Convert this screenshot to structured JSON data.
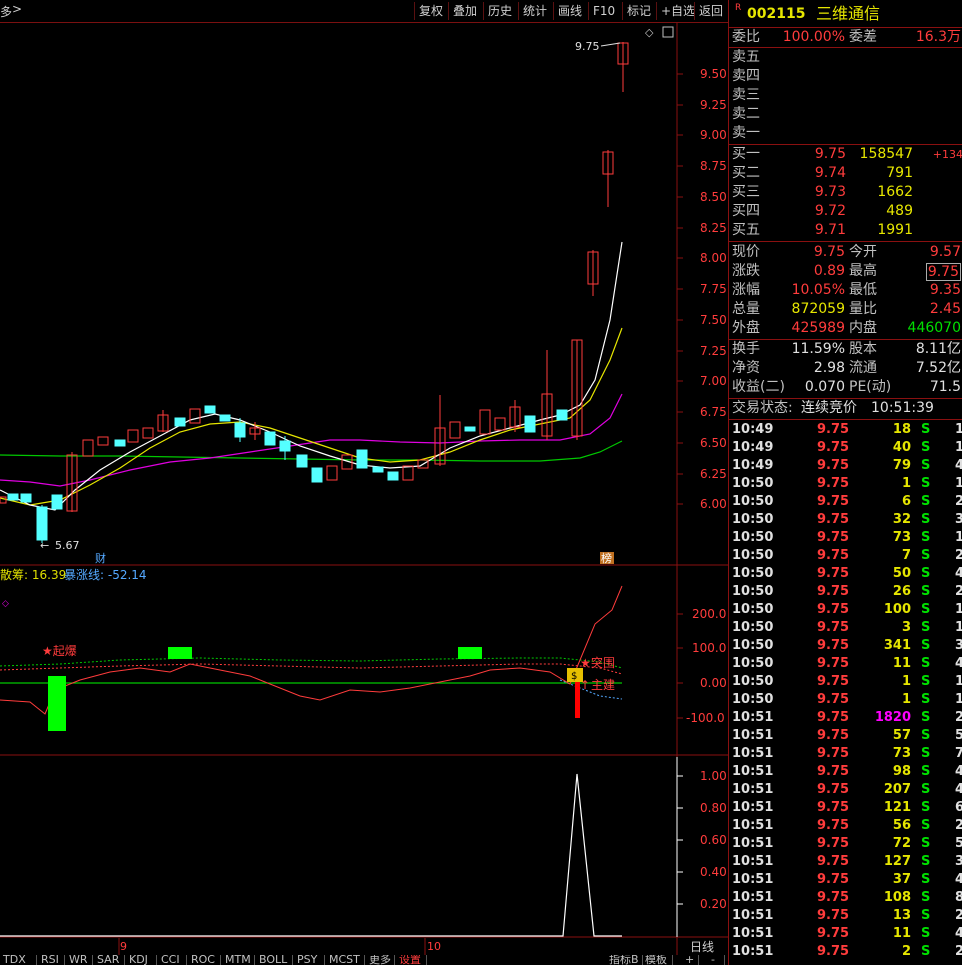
{
  "topbar": {
    "left_label": "多",
    "buttons": [
      "复权",
      "叠加",
      "历史",
      "统计",
      "画线",
      "F10",
      "标记",
      "+自选",
      "返回"
    ]
  },
  "stock": {
    "marker": "R",
    "code": "002115",
    "name": "三维通信"
  },
  "order_ratio": {
    "label1": "委比",
    "value1": "100.00%",
    "label2": "委差",
    "value2": "16.3万"
  },
  "sell_levels": [
    "卖五",
    "卖四",
    "卖三",
    "卖二",
    "卖一"
  ],
  "buy_levels": [
    {
      "label": "买一",
      "price": "9.75",
      "vol": "158547",
      "chg": "+134"
    },
    {
      "label": "买二",
      "price": "9.74",
      "vol": "791",
      "chg": ""
    },
    {
      "label": "买三",
      "price": "9.73",
      "vol": "1662",
      "chg": ""
    },
    {
      "label": "买四",
      "price": "9.72",
      "vol": "489",
      "chg": ""
    },
    {
      "label": "买五",
      "price": "9.71",
      "vol": "1991",
      "chg": ""
    }
  ],
  "quote": [
    {
      "l1": "现价",
      "v1": "9.75",
      "l2": "今开",
      "v2": "9.57"
    },
    {
      "l1": "涨跌",
      "v1": "0.89",
      "l2": "最高",
      "v2": "9.75"
    },
    {
      "l1": "涨幅",
      "v1": "10.05%",
      "l2": "最低",
      "v2": "9.35"
    },
    {
      "l1": "总量",
      "v1": "872059",
      "l2": "量比",
      "v2": "2.45"
    },
    {
      "l1": "外盘",
      "v1": "425989",
      "l2": "内盘",
      "v2": "446070"
    }
  ],
  "stats": [
    {
      "l1": "换手",
      "v1": "11.59%",
      "l2": "股本",
      "v2": "8.11亿"
    },
    {
      "l1": "净资",
      "v1": "2.98",
      "l2": "流通",
      "v2": "7.52亿"
    },
    {
      "l1": "收益(二)",
      "v1": "0.070",
      "l2": "PE(动)",
      "v2": "71.5"
    }
  ],
  "trade_status": {
    "label": "交易状态:",
    "status": "连续竞价",
    "time": "10:51:39"
  },
  "ticks": [
    {
      "t": "10:49",
      "p": "9.75",
      "v": "18",
      "s": "S",
      "n": "1"
    },
    {
      "t": "10:49",
      "p": "9.75",
      "v": "40",
      "s": "S",
      "n": "1"
    },
    {
      "t": "10:49",
      "p": "9.75",
      "v": "79",
      "s": "S",
      "n": "4"
    },
    {
      "t": "10:50",
      "p": "9.75",
      "v": "1",
      "s": "S",
      "n": "1"
    },
    {
      "t": "10:50",
      "p": "9.75",
      "v": "6",
      "s": "S",
      "n": "2"
    },
    {
      "t": "10:50",
      "p": "9.75",
      "v": "32",
      "s": "S",
      "n": "3"
    },
    {
      "t": "10:50",
      "p": "9.75",
      "v": "73",
      "s": "S",
      "n": "1"
    },
    {
      "t": "10:50",
      "p": "9.75",
      "v": "7",
      "s": "S",
      "n": "2"
    },
    {
      "t": "10:50",
      "p": "9.75",
      "v": "50",
      "s": "S",
      "n": "4"
    },
    {
      "t": "10:50",
      "p": "9.75",
      "v": "26",
      "s": "S",
      "n": "2"
    },
    {
      "t": "10:50",
      "p": "9.75",
      "v": "100",
      "s": "S",
      "n": "1"
    },
    {
      "t": "10:50",
      "p": "9.75",
      "v": "3",
      "s": "S",
      "n": "1"
    },
    {
      "t": "10:50",
      "p": "9.75",
      "v": "341",
      "s": "S",
      "n": "3"
    },
    {
      "t": "10:50",
      "p": "9.75",
      "v": "11",
      "s": "S",
      "n": "4"
    },
    {
      "t": "10:50",
      "p": "9.75",
      "v": "1",
      "s": "S",
      "n": "1"
    },
    {
      "t": "10:50",
      "p": "9.75",
      "v": "1",
      "s": "S",
      "n": "1"
    },
    {
      "t": "10:51",
      "p": "9.75",
      "v": "1820",
      "s": "S",
      "n": "2",
      "big": true
    },
    {
      "t": "10:51",
      "p": "9.75",
      "v": "57",
      "s": "S",
      "n": "5"
    },
    {
      "t": "10:51",
      "p": "9.75",
      "v": "73",
      "s": "S",
      "n": "7"
    },
    {
      "t": "10:51",
      "p": "9.75",
      "v": "98",
      "s": "S",
      "n": "4"
    },
    {
      "t": "10:51",
      "p": "9.75",
      "v": "207",
      "s": "S",
      "n": "4"
    },
    {
      "t": "10:51",
      "p": "9.75",
      "v": "121",
      "s": "S",
      "n": "6"
    },
    {
      "t": "10:51",
      "p": "9.75",
      "v": "56",
      "s": "S",
      "n": "2"
    },
    {
      "t": "10:51",
      "p": "9.75",
      "v": "72",
      "s": "S",
      "n": "5"
    },
    {
      "t": "10:51",
      "p": "9.75",
      "v": "127",
      "s": "S",
      "n": "3"
    },
    {
      "t": "10:51",
      "p": "9.75",
      "v": "37",
      "s": "S",
      "n": "4"
    },
    {
      "t": "10:51",
      "p": "9.75",
      "v": "108",
      "s": "S",
      "n": "8"
    },
    {
      "t": "10:51",
      "p": "9.75",
      "v": "13",
      "s": "S",
      "n": "2"
    },
    {
      "t": "10:51",
      "p": "9.75",
      "v": "11",
      "s": "S",
      "n": "4"
    },
    {
      "t": "10:51",
      "p": "9.75",
      "v": "2",
      "s": "S",
      "n": "2"
    }
  ],
  "chart": {
    "price_axis": [
      "9.50",
      "9.25",
      "9.00",
      "8.75",
      "8.50",
      "8.25",
      "8.00",
      "7.75",
      "7.50",
      "7.25",
      "7.00",
      "6.75",
      "6.50",
      "6.25",
      "6.00"
    ],
    "high_label": "9.75",
    "low_label": "5.67",
    "mark_cai": "财",
    "mark_bang": "榜",
    "indicator_label1": "散筹: 16.39",
    "indicator_label2": "暴涨线: -52.14",
    "ind_axis": [
      "200.0",
      "100.0",
      "0.00",
      "-100.0"
    ],
    "vol_axis": [
      "1.00",
      "0.80",
      "0.60",
      "0.40",
      "0.20"
    ],
    "signal_qibao": "★起爆",
    "signal_tupo": "突围",
    "signal_zhuli": "主建",
    "date_labels": [
      "9",
      "10"
    ],
    "period": "日线"
  },
  "bottom_tabs": [
    "TDX",
    "RSI",
    "WR",
    "SAR",
    "KDJ",
    "CCI",
    "ROC",
    "MTM",
    "BOLL",
    "PSY",
    "MCST",
    "更多",
    "设置"
  ],
  "bottom_right": [
    "指标B",
    "模板",
    "+",
    "-"
  ]
}
